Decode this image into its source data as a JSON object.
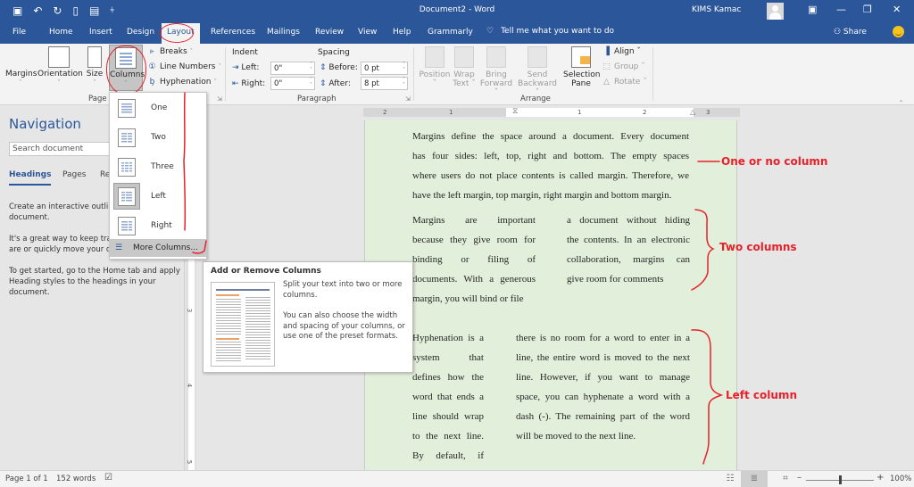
{
  "titlebar": {
    "qat_icons": [
      "save-icon",
      "undo-icon",
      "redo-icon",
      "new-document-icon",
      "open-folder-icon",
      "customize-qat-icon"
    ],
    "qat_glyphs": [
      "▣",
      "↶",
      "↻",
      "▯",
      "▤",
      "⫩"
    ],
    "document_title": "Document2 - Word",
    "user_name": "KIMS Kamac",
    "ribbon_display_glyph": "▣",
    "minimize_glyph": "—",
    "restore_glyph": "❐",
    "close_glyph": "✕"
  },
  "tabs": [
    {
      "label": "File"
    },
    {
      "label": "Home"
    },
    {
      "label": "Insert"
    },
    {
      "label": "Design"
    },
    {
      "label": "Layout",
      "active": true
    },
    {
      "label": "References"
    },
    {
      "label": "Mailings"
    },
    {
      "label": "Review"
    },
    {
      "label": "View"
    },
    {
      "label": "Help"
    },
    {
      "label": "Grammarly"
    }
  ],
  "tell_me": {
    "icon_glyph": "♡",
    "text": "Tell me what you want to do"
  },
  "share": {
    "label": "⚇ Share"
  },
  "ribbon": {
    "page_setup": {
      "margins": "Margins",
      "orientation": "Orientation",
      "size": "Size",
      "columns": "Columns",
      "breaks": "Breaks",
      "line_numbers": "Line Numbers",
      "hyphenation": "Hyphenation",
      "group_label": "Page S",
      "caret": "ˇ",
      "dd": "ˇ",
      "launcher": "⇲"
    },
    "paragraph": {
      "indent_label": "Indent",
      "spacing_label": "Spacing",
      "left_label": "Left:",
      "right_label": "Right:",
      "before_label": "Before:",
      "after_label": "After:",
      "left_value": "0\"",
      "right_value": "0\"",
      "before_value": "0 pt",
      "after_value": "8 pt",
      "group_label": "Paragraph",
      "spin_glyph": "˄\n˅"
    },
    "arrange": {
      "position": "Position",
      "wrap_text_1": "Wrap",
      "wrap_text_2": "Text ˇ",
      "bring_forward_1": "Bring",
      "bring_forward_2": "Forward ˇ",
      "send_backward_1": "Send",
      "send_backward_2": "Backward ˇ",
      "selection_pane_1": "Selection",
      "selection_pane_2": "Pane",
      "align": "Align ˇ",
      "group": "Group ˇ",
      "rotate": "Rotate ˇ",
      "group_label": "Arrange"
    },
    "collapse_glyph": "‸"
  },
  "columns_menu": {
    "items": [
      {
        "label": "One",
        "cols": 1
      },
      {
        "label": "Two",
        "cols": 2
      },
      {
        "label": "Three",
        "cols": 3
      },
      {
        "label": "Left",
        "cols": 2,
        "selected": true
      },
      {
        "label": "Right",
        "cols": 2
      }
    ],
    "more_columns": "More Columns...",
    "more_icon_glyph": "☰"
  },
  "tooltip": {
    "title": "Add or Remove Columns",
    "line1": "Split your text into two or more columns.",
    "line2": "You can also choose the width and spacing of your columns, or use one of the preset formats."
  },
  "navigation": {
    "title": "Navigation",
    "search_placeholder": "Search document",
    "tabs": [
      "Headings",
      "Pages",
      "Re"
    ],
    "para1": "Create an interactive outline of your document.",
    "para2": "It's a great way to keep track of where you are or quickly move your content around.",
    "para3": "To get started, go to the Home tab and apply Heading styles to the headings in your document."
  },
  "rulers": {
    "horizontal_numbers": [
      "2",
      "1",
      "1",
      "2",
      "3"
    ],
    "vertical_numbers": [
      "3",
      "4",
      "5"
    ]
  },
  "document": {
    "one_column": [
      "Margins define the space around a document. Every document",
      "has four sides: left, top, right and bottom. The empty spaces",
      "where users do not place contents is called margin. Therefore, we",
      "have the left margin, top margin, right margin and bottom margin."
    ],
    "two_columns_left": [
      "Margins are important",
      "because they give room for",
      "binding or filing of",
      "documents. With a generous",
      "margin, you will bind or file"
    ],
    "two_columns_right": [
      "a document without hiding",
      "the contents. In an electronic",
      "collaboration, margins can",
      "give room for comments"
    ],
    "left_column_left": [
      "Hyphenation is a",
      "system that",
      "defines how the",
      "word that ends a",
      "line should wrap",
      "to the next line.",
      "By default, if"
    ],
    "left_column_right": [
      "there is no room for a word to enter in a",
      "line, the entire word is moved to the next",
      "line. However, if you want to manage",
      "space, you can hyphenate a word with a",
      "dash (-). The remaining part of the word",
      "will be moved to the next line."
    ]
  },
  "annotations": {
    "one_column": "One or no column",
    "two_columns": "Two columns",
    "left_column": "Left column",
    "color": "#e8202a"
  },
  "statusbar": {
    "page": "Page 1 of 1",
    "words": "152 words",
    "proofing_glyph": "☑",
    "read_mode_glyph": "☷",
    "print_layout_glyph": "≣",
    "web_layout_glyph": "⌗",
    "zoom_minus": "–",
    "zoom_plus": "+",
    "zoom_level": "100%",
    "zoom_fraction": 0.5
  },
  "colors": {
    "accent": "#2b579a",
    "page_bg": "#e2efda",
    "annotation": "#e8202a"
  }
}
